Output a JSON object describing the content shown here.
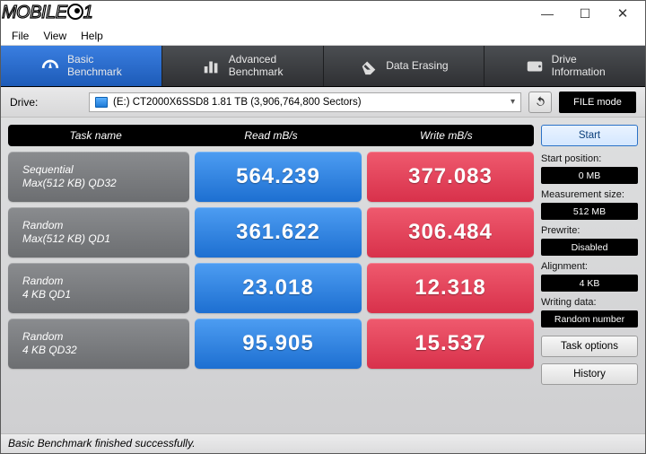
{
  "menubar": {
    "file": "File",
    "view": "View",
    "help": "Help"
  },
  "tabs": {
    "basic": "Basic\nBenchmark",
    "advanced": "Advanced\nBenchmark",
    "erasing": "Data Erasing",
    "driveinfo": "Drive\nInformation"
  },
  "toolbar": {
    "drive_label": "Drive:",
    "drive_value": "(E:) CT2000X6SSD8  1.81 TB (3,906,764,800 Sectors)",
    "filemode": "FILE mode"
  },
  "headers": {
    "task": "Task name",
    "read": "Read mB/s",
    "write": "Write mB/s"
  },
  "rows": [
    {
      "t1": "Sequential",
      "t2": "Max(512 KB) QD32",
      "read": "564.239",
      "write": "377.083"
    },
    {
      "t1": "Random",
      "t2": "Max(512 KB) QD1",
      "read": "361.622",
      "write": "306.484"
    },
    {
      "t1": "Random",
      "t2": "4 KB QD1",
      "read": "23.018",
      "write": "12.318"
    },
    {
      "t1": "Random",
      "t2": "4 KB QD32",
      "read": "95.905",
      "write": "15.537"
    }
  ],
  "side": {
    "start": "Start",
    "startpos_l": "Start position:",
    "startpos_v": "0 MB",
    "msize_l": "Measurement size:",
    "msize_v": "512 MB",
    "prewrite_l": "Prewrite:",
    "prewrite_v": "Disabled",
    "align_l": "Alignment:",
    "align_v": "4 KB",
    "wdata_l": "Writing data:",
    "wdata_v": "Random number",
    "taskopt": "Task options",
    "history": "History"
  },
  "status": "Basic Benchmark finished successfully."
}
